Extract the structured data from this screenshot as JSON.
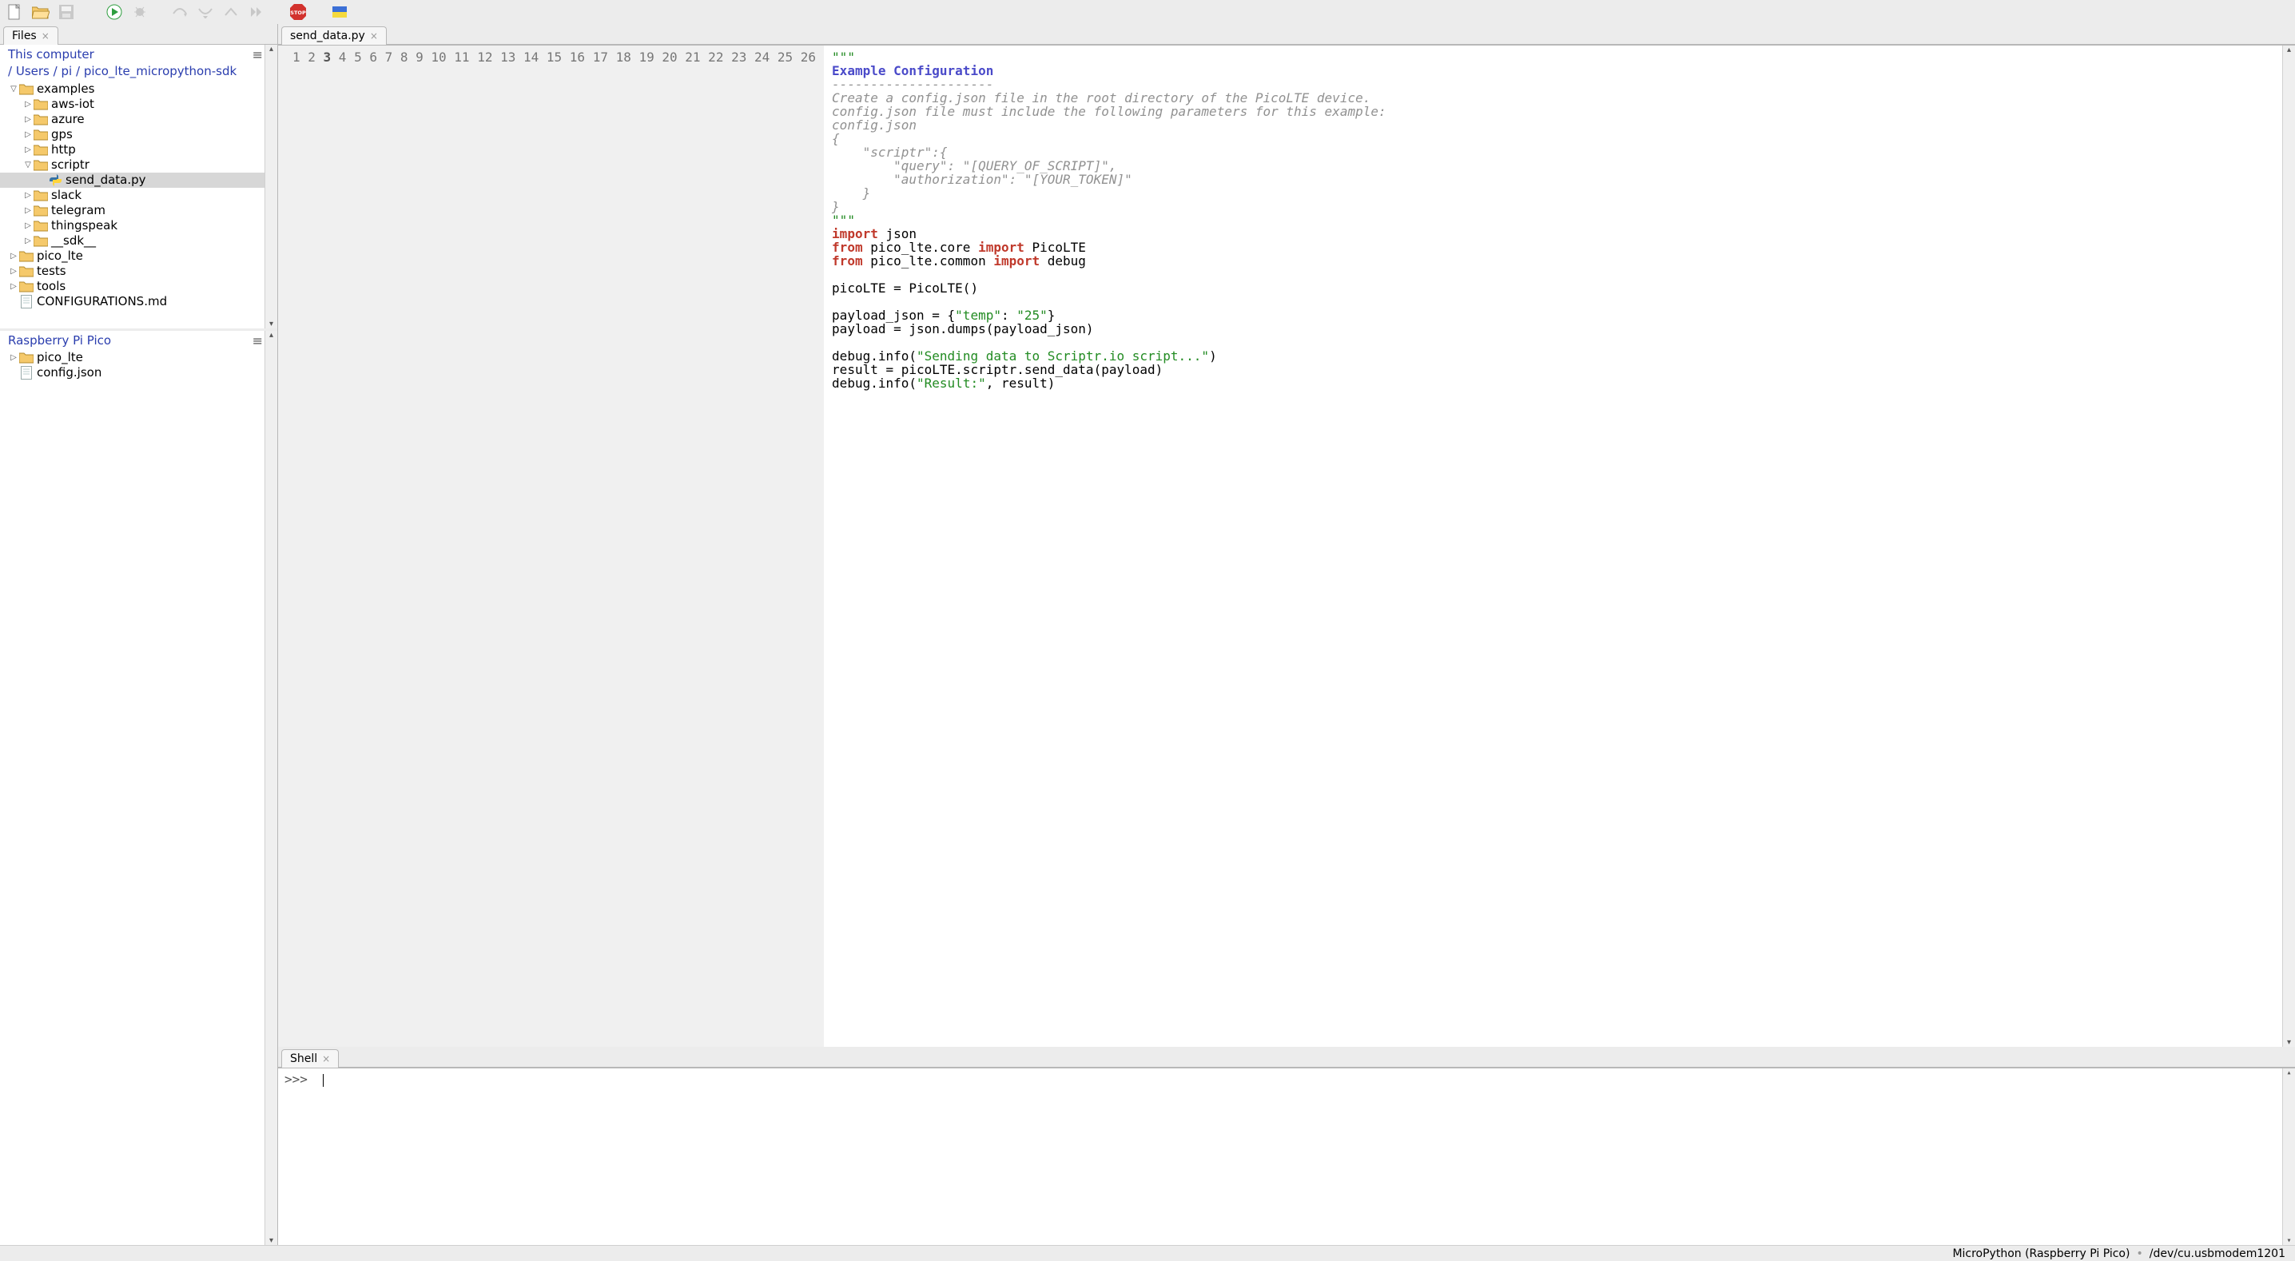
{
  "toolbar": {
    "new_tip": "New",
    "open_tip": "Open",
    "save_tip": "Save",
    "run_tip": "Run",
    "debug_tip": "Debug",
    "undo_tip": "Undo",
    "redo_tip": "Redo",
    "stepover_tip": "Step over",
    "stepin_tip": "Step into",
    "resume_tip": "Resume",
    "stop_label": "STOP",
    "stop_tip": "Stop",
    "zoom_tip": "Zoom"
  },
  "files_tab_label": "Files",
  "files_local": {
    "title": "This computer",
    "breadcrumb": [
      "/",
      "Users",
      "/",
      "pi",
      "/",
      "pico_lte_micropython-sdk"
    ],
    "tree": [
      {
        "arrow": "down",
        "icon": "folder",
        "name": "examples",
        "indent": 1
      },
      {
        "arrow": "right",
        "icon": "folder",
        "name": "aws-iot",
        "indent": 2
      },
      {
        "arrow": "right",
        "icon": "folder",
        "name": "azure",
        "indent": 2
      },
      {
        "arrow": "right",
        "icon": "folder",
        "name": "gps",
        "indent": 2
      },
      {
        "arrow": "right",
        "icon": "folder",
        "name": "http",
        "indent": 2
      },
      {
        "arrow": "down",
        "icon": "folder",
        "name": "scriptr",
        "indent": 2
      },
      {
        "arrow": "",
        "icon": "python",
        "name": "send_data.py",
        "indent": 3,
        "selected": true
      },
      {
        "arrow": "right",
        "icon": "folder",
        "name": "slack",
        "indent": 2
      },
      {
        "arrow": "right",
        "icon": "folder",
        "name": "telegram",
        "indent": 2
      },
      {
        "arrow": "right",
        "icon": "folder",
        "name": "thingspeak",
        "indent": 2
      },
      {
        "arrow": "right",
        "icon": "folder",
        "name": "__sdk__",
        "indent": 2
      },
      {
        "arrow": "right",
        "icon": "folder",
        "name": "pico_lte",
        "indent": 1
      },
      {
        "arrow": "right",
        "icon": "folder",
        "name": "tests",
        "indent": 1
      },
      {
        "arrow": "right",
        "icon": "folder",
        "name": "tools",
        "indent": 1
      },
      {
        "arrow": "",
        "icon": "file",
        "name": "CONFIGURATIONS.md",
        "indent": 1
      }
    ]
  },
  "files_device": {
    "title": "Raspberry Pi Pico",
    "tree": [
      {
        "arrow": "right",
        "icon": "folder",
        "name": "pico_lte",
        "indent": 1
      },
      {
        "arrow": "",
        "icon": "file",
        "name": "config.json",
        "indent": 1
      }
    ]
  },
  "editor": {
    "tab_label": "send_data.py",
    "line_count": 26,
    "current_line": 3,
    "lines": {
      "l1": "\"\"\"",
      "l2": "Example Configuration",
      "l3": "---------------------",
      "l4": "Create a config.json file in the root directory of the PicoLTE device.",
      "l5": "config.json file must include the following parameters for this example:",
      "l6": "config.json",
      "l7": "{",
      "l8": "    \"scriptr\":{",
      "l9": "        \"query\": \"[QUERY_OF_SCRIPT]\",",
      "l10": "        \"authorization\": \"[YOUR_TOKEN]\"",
      "l11": "    }",
      "l12": "}",
      "l13": "\"\"\"",
      "l14_import": "import",
      "l14_rest": " json",
      "l15_from": "from",
      "l15_mid": " pico_lte.core ",
      "l15_import": "import",
      "l15_rest": " PicoLTE",
      "l16_from": "from",
      "l16_mid": " pico_lte.common ",
      "l16_import": "import",
      "l16_rest": " debug",
      "l17": "",
      "l18": "picoLTE = PicoLTE()",
      "l19": "",
      "l20_a": "payload_json = {",
      "l20_b": "\"temp\"",
      "l20_c": ": ",
      "l20_d": "\"25\"",
      "l20_e": "}",
      "l21": "payload = json.dumps(payload_json)",
      "l22": "",
      "l23_a": "debug.info(",
      "l23_b": "\"Sending data to Scriptr.io script...\"",
      "l23_c": ")",
      "l24": "result = picoLTE.scriptr.send_data(payload)",
      "l25_a": "debug.info(",
      "l25_b": "\"Result:\"",
      "l25_c": ", result)",
      "l26": ""
    }
  },
  "shell": {
    "tab_label": "Shell",
    "prompt": ">>>"
  },
  "status": {
    "interpreter": "MicroPython (Raspberry Pi Pico)",
    "port": "/dev/cu.usbmodem1201"
  }
}
